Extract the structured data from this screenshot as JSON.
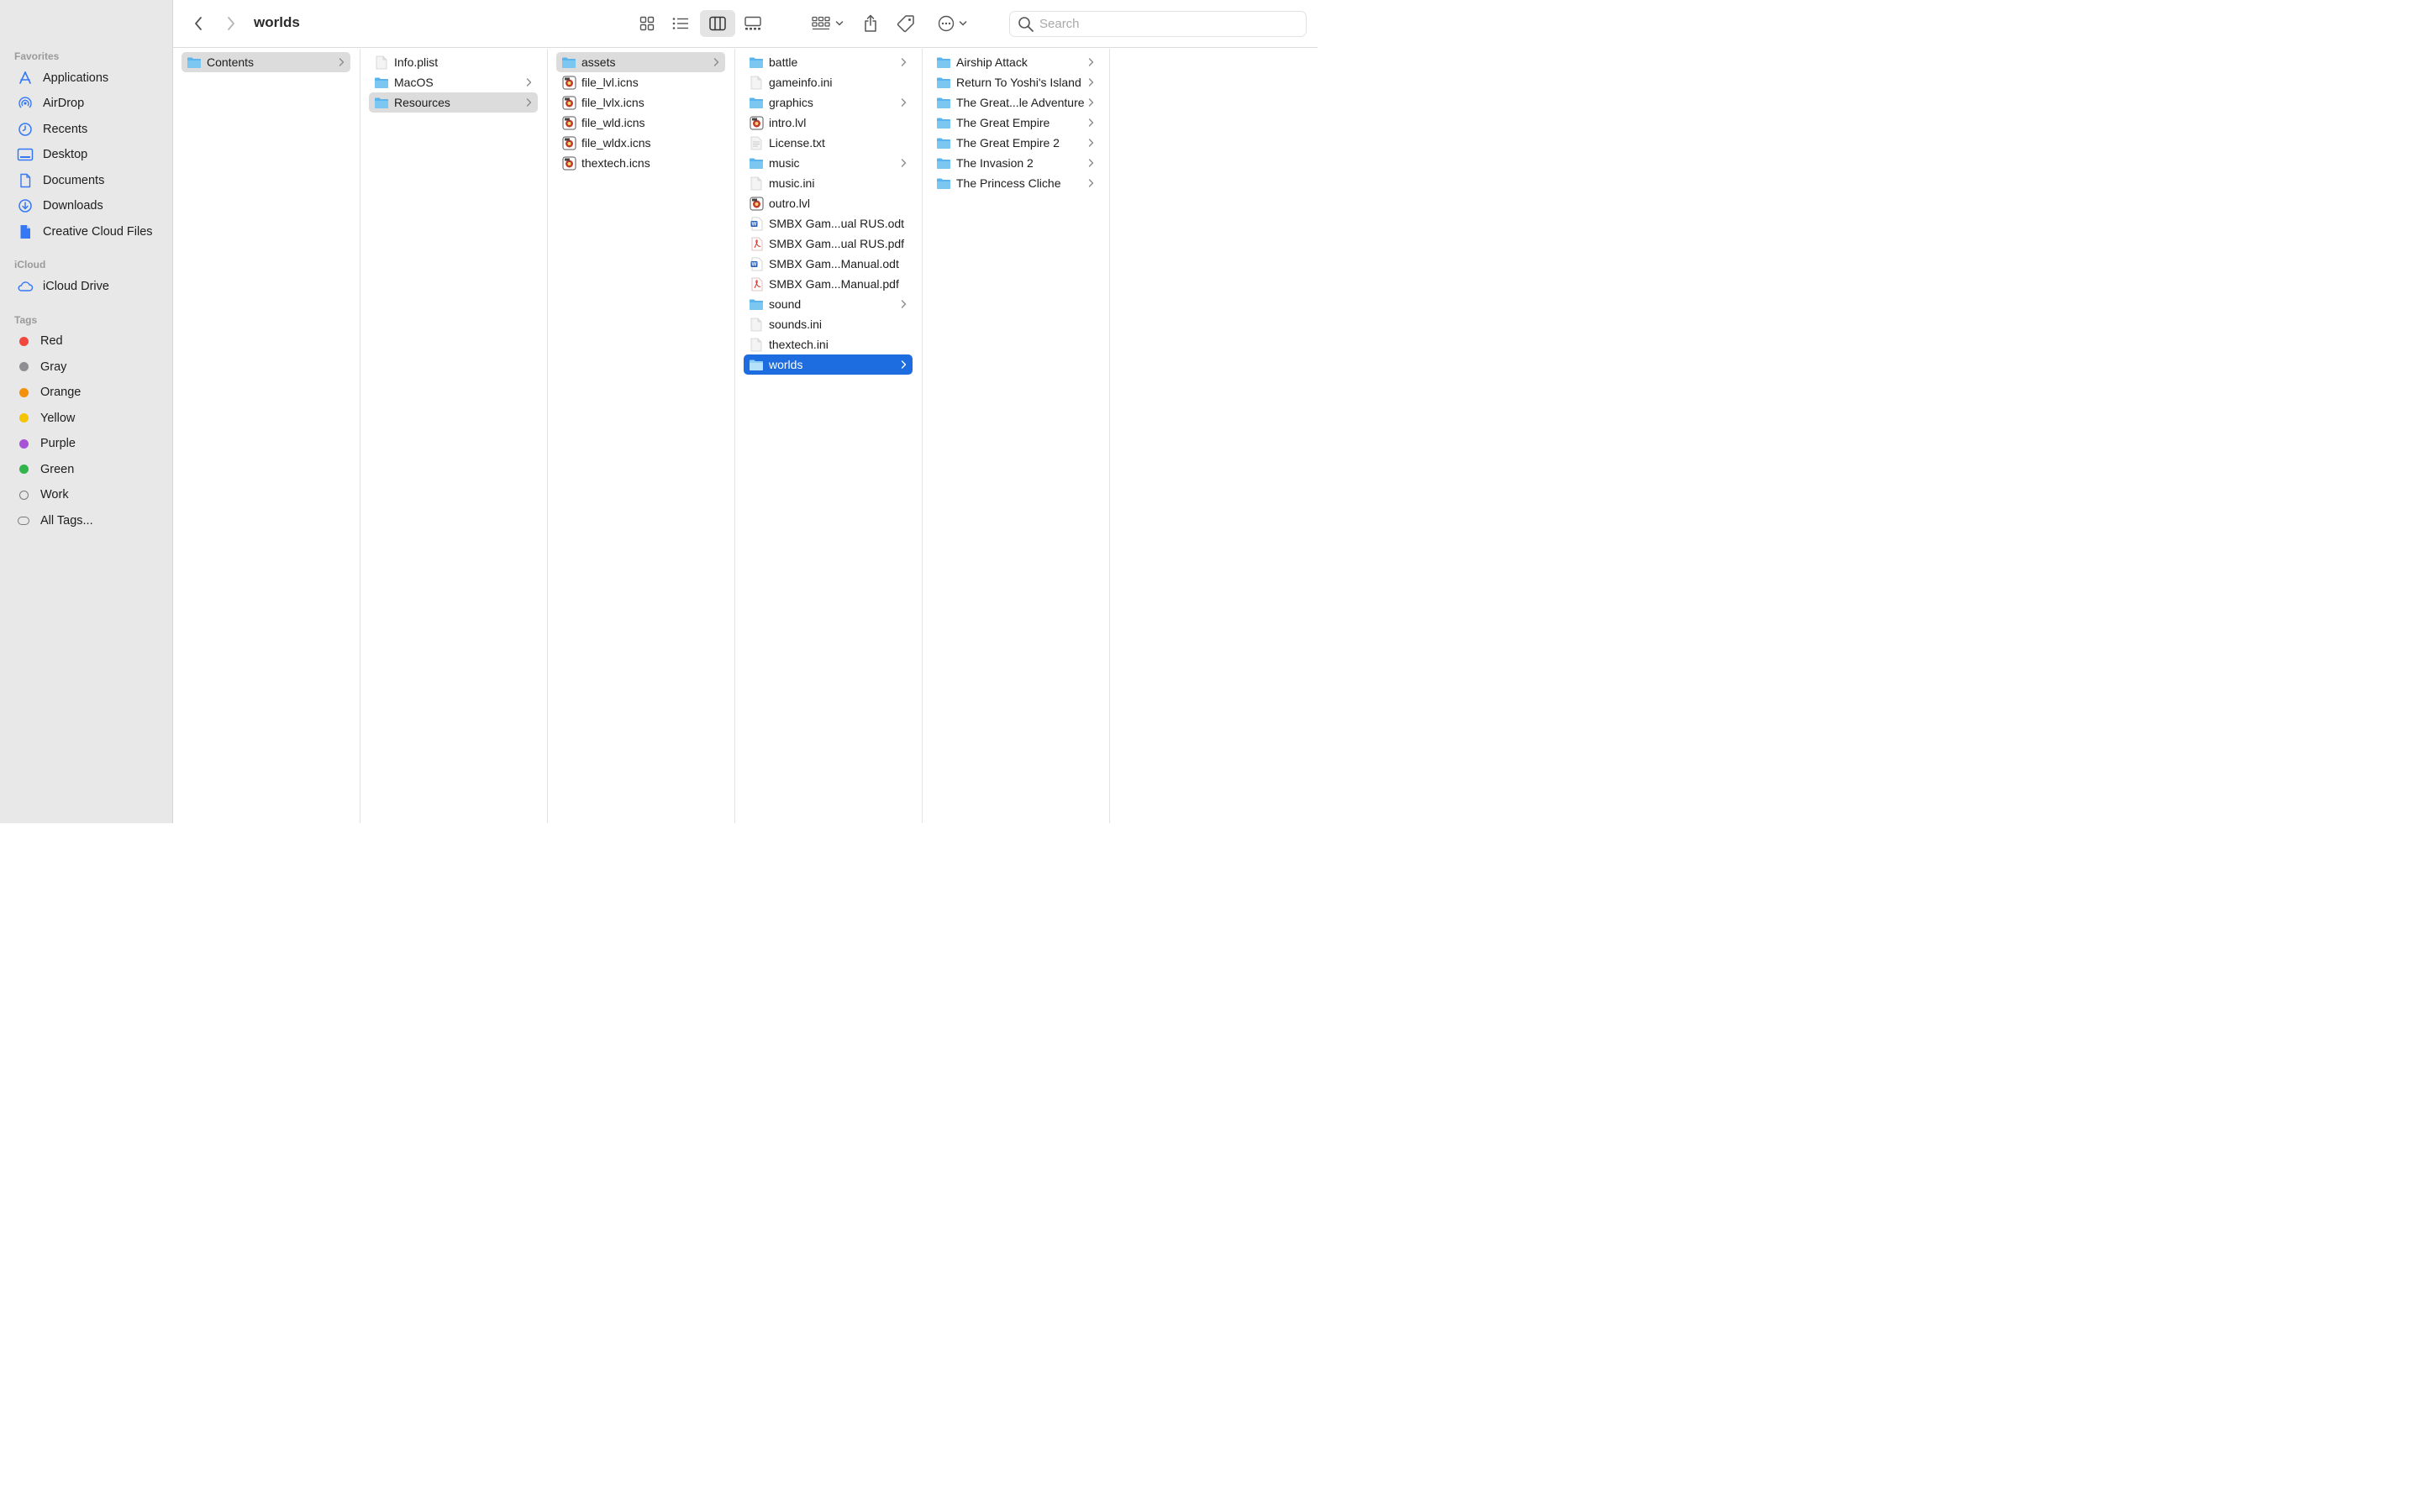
{
  "window": {
    "title": "worlds"
  },
  "search": {
    "placeholder": "Search"
  },
  "colors": {
    "accent": "#1d6ce0",
    "folder": "#5ab4ee",
    "sidebar_icon": "#3478f6"
  },
  "sidebar": {
    "favorites_label": "Favorites",
    "favorites": [
      {
        "label": "Applications",
        "icon": "applications-icon"
      },
      {
        "label": "AirDrop",
        "icon": "airdrop-icon"
      },
      {
        "label": "Recents",
        "icon": "clock-icon"
      },
      {
        "label": "Desktop",
        "icon": "desktop-icon"
      },
      {
        "label": "Documents",
        "icon": "document-icon"
      },
      {
        "label": "Downloads",
        "icon": "download-icon"
      },
      {
        "label": "Creative Cloud Files",
        "icon": "file-icon"
      }
    ],
    "icloud_label": "iCloud",
    "icloud": [
      {
        "label": "iCloud Drive",
        "icon": "cloud-icon"
      }
    ],
    "tags_label": "Tags",
    "tags": [
      {
        "label": "Red",
        "color": "#f2473e"
      },
      {
        "label": "Gray",
        "color": "#8e8e93"
      },
      {
        "label": "Orange",
        "color": "#f5900a"
      },
      {
        "label": "Yellow",
        "color": "#f5c400"
      },
      {
        "label": "Purple",
        "color": "#a853d6"
      },
      {
        "label": "Green",
        "color": "#2fb54a"
      },
      {
        "label": "Work",
        "color": ""
      },
      {
        "label": "All Tags...",
        "color": ""
      }
    ]
  },
  "columns": [
    {
      "items": [
        {
          "name": "Contents",
          "kind": "folder",
          "chevron": true,
          "selected": "grey"
        }
      ]
    },
    {
      "items": [
        {
          "name": "Info.plist",
          "kind": "file",
          "chevron": false,
          "selected": ""
        },
        {
          "name": "MacOS",
          "kind": "folder",
          "chevron": true,
          "selected": ""
        },
        {
          "name": "Resources",
          "kind": "folder",
          "chevron": true,
          "selected": "grey"
        }
      ]
    },
    {
      "items": [
        {
          "name": "assets",
          "kind": "folder",
          "chevron": true,
          "selected": "grey"
        },
        {
          "name": "file_lvl.icns",
          "kind": "app",
          "chevron": false,
          "selected": ""
        },
        {
          "name": "file_lvlx.icns",
          "kind": "app",
          "chevron": false,
          "selected": ""
        },
        {
          "name": "file_wld.icns",
          "kind": "app",
          "chevron": false,
          "selected": ""
        },
        {
          "name": "file_wldx.icns",
          "kind": "app",
          "chevron": false,
          "selected": ""
        },
        {
          "name": "thextech.icns",
          "kind": "app",
          "chevron": false,
          "selected": ""
        }
      ]
    },
    {
      "items": [
        {
          "name": "battle",
          "kind": "folder",
          "chevron": true,
          "selected": ""
        },
        {
          "name": "gameinfo.ini",
          "kind": "file",
          "chevron": false,
          "selected": ""
        },
        {
          "name": "graphics",
          "kind": "folder",
          "chevron": true,
          "selected": ""
        },
        {
          "name": "intro.lvl",
          "kind": "app",
          "chevron": false,
          "selected": ""
        },
        {
          "name": "License.txt",
          "kind": "text",
          "chevron": false,
          "selected": ""
        },
        {
          "name": "music",
          "kind": "folder",
          "chevron": true,
          "selected": ""
        },
        {
          "name": "music.ini",
          "kind": "file",
          "chevron": false,
          "selected": ""
        },
        {
          "name": "outro.lvl",
          "kind": "app",
          "chevron": false,
          "selected": ""
        },
        {
          "name": "SMBX Gam...ual RUS.odt",
          "kind": "word",
          "chevron": false,
          "selected": ""
        },
        {
          "name": "SMBX Gam...ual RUS.pdf",
          "kind": "pdf",
          "chevron": false,
          "selected": ""
        },
        {
          "name": "SMBX Gam...Manual.odt",
          "kind": "word",
          "chevron": false,
          "selected": ""
        },
        {
          "name": "SMBX Gam...Manual.pdf",
          "kind": "pdf",
          "chevron": false,
          "selected": ""
        },
        {
          "name": "sound",
          "kind": "folder",
          "chevron": true,
          "selected": ""
        },
        {
          "name": "sounds.ini",
          "kind": "file",
          "chevron": false,
          "selected": ""
        },
        {
          "name": "thextech.ini",
          "kind": "file",
          "chevron": false,
          "selected": ""
        },
        {
          "name": "worlds",
          "kind": "folder",
          "chevron": true,
          "selected": "blue"
        }
      ]
    },
    {
      "items": [
        {
          "name": "Airship Attack",
          "kind": "folder",
          "chevron": true,
          "selected": ""
        },
        {
          "name": "Return To Yoshi's Island",
          "kind": "folder",
          "chevron": true,
          "selected": ""
        },
        {
          "name": "The Great...le Adventure",
          "kind": "folder",
          "chevron": true,
          "selected": ""
        },
        {
          "name": "The Great Empire",
          "kind": "folder",
          "chevron": true,
          "selected": ""
        },
        {
          "name": "The Great Empire 2",
          "kind": "folder",
          "chevron": true,
          "selected": ""
        },
        {
          "name": "The Invasion 2",
          "kind": "folder",
          "chevron": true,
          "selected": ""
        },
        {
          "name": "The Princess Cliche",
          "kind": "folder",
          "chevron": true,
          "selected": ""
        }
      ]
    }
  ]
}
